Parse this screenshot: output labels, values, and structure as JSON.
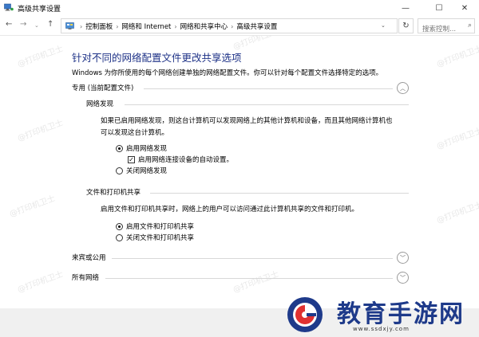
{
  "window": {
    "title": "高级共享设置",
    "min": "—",
    "max": "☐",
    "close": "✕"
  },
  "addressbar": {
    "back": "←",
    "forward": "→",
    "dropdown": "⌄",
    "up": "↑",
    "crumb_start": "›",
    "breadcrumbs": [
      "控制面板",
      "网络和 Internet",
      "网络和共享中心",
      "高级共享设置"
    ],
    "separator": "›",
    "refresh": "↻",
    "search_placeholder": "搜索控制...",
    "search_icon": "⌕"
  },
  "main": {
    "heading": "针对不同的网络配置文件更改共享选项",
    "intro": "Windows 为你所使用的每个网络创建单独的网络配置文件。你可以针对每个配置文件选择特定的选项。",
    "private": {
      "label": "专用 (当前配置文件)",
      "chevron": "︿",
      "discovery": {
        "label": "网络发现",
        "desc_line1": "如果已启用网络发现，则这台计算机可以发现网络上的其他计算机和设备，而且其他网络计算机也",
        "desc_line2": "可以发现这台计算机。",
        "on": "启用网络发现",
        "auto": "启用网络连接设备的自动设置。",
        "off": "关闭网络发现"
      },
      "sharing": {
        "label": "文件和打印机共享",
        "desc": "启用文件和打印机共享时，网络上的用户可以访问通过此计算机共享的文件和打印机。",
        "on": "启用文件和打印机共享",
        "off": "关闭文件和打印机共享"
      }
    },
    "guest": {
      "label": "来宾或公用",
      "chevron": "﹀"
    },
    "all": {
      "label": "所有网络",
      "chevron": "﹀"
    }
  },
  "watermark": "@打印机卫士",
  "logo": {
    "brand": "教育手游网",
    "url": "www.ssdxjy.com"
  },
  "colors": {
    "heading": "#1e3287",
    "logo": "#1e3a8a"
  }
}
